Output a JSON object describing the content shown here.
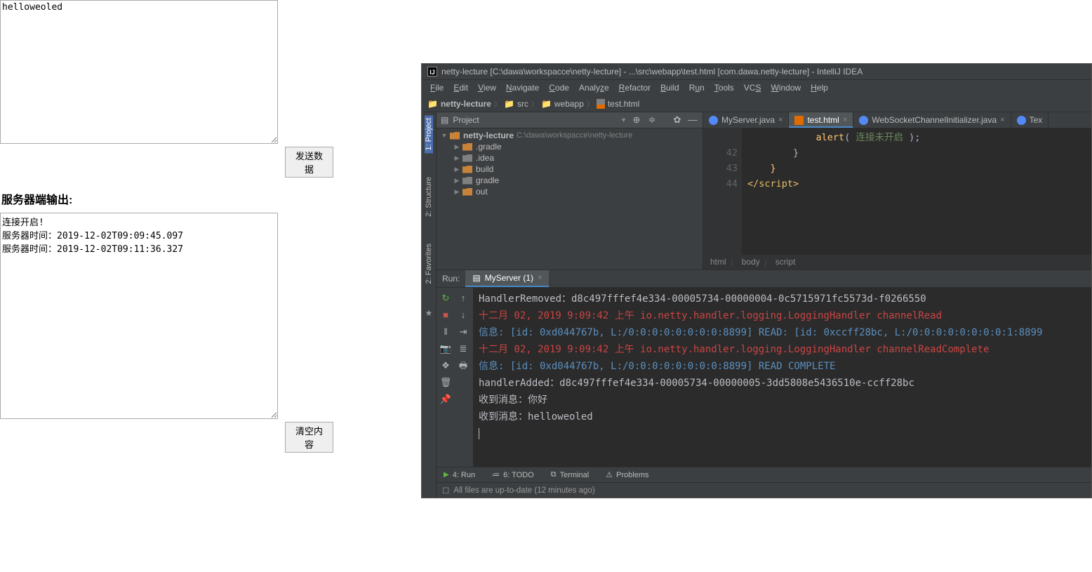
{
  "browser": {
    "input_value": "helloweoled",
    "send_button": "发送数据",
    "output_title": "服务器端输出:",
    "output_value": "连接开启!\n服务器时间：2019-12-02T09:09:45.097\n服务器时间：2019-12-02T09:11:36.327",
    "clear_button": "清空内容"
  },
  "ide": {
    "title": "netty-lecture [C:\\dawa\\workspacce\\netty-lecture] - ...\\src\\webapp\\test.html [com.dawa.netty-lecture] - IntelliJ IDEA",
    "menu": [
      "File",
      "Edit",
      "View",
      "Navigate",
      "Code",
      "Analyze",
      "Refactor",
      "Build",
      "Run",
      "Tools",
      "VCS",
      "Window",
      "Help"
    ],
    "path": {
      "root": "netty-lecture",
      "src": "src",
      "webapp": "webapp",
      "file": "test.html"
    },
    "project": {
      "header": "Project",
      "root_name": "netty-lecture",
      "root_path": "C:\\dawa\\workspacce\\netty-lecture",
      "folders": [
        ".gradle",
        ".idea",
        "build",
        "gradle",
        "out"
      ]
    },
    "editor_tabs": [
      {
        "label": "MyServer.java",
        "type": "java"
      },
      {
        "label": "test.html",
        "type": "html",
        "active": true
      },
      {
        "label": "WebSocketChannelInitializer.java",
        "type": "java"
      },
      {
        "label": "Tex",
        "type": "java"
      }
    ],
    "code_lines": {
      "l42": "42",
      "l43": "43",
      "l44": "44"
    },
    "breadcrumbs": [
      "html",
      "body",
      "script"
    ],
    "run": {
      "label": "Run:",
      "tab": "MyServer (1)"
    },
    "console_lines": [
      {
        "cls": "",
        "text": "HandlerRemoved：d8c497fffef4e334-00005734-00000004-0c5715971fc5573d-f0266550"
      },
      {
        "cls": "red",
        "text": "十二月 02, 2019 9:09:42 上午 io.netty.handler.logging.LoggingHandler channelRead"
      },
      {
        "cls": "blue",
        "text": "信息: [id: 0xd044767b, L:/0:0:0:0:0:0:0:0:8899] READ: [id: 0xccff28bc, L:/0:0:0:0:0:0:0:0:1:8899"
      },
      {
        "cls": "red",
        "text": "十二月 02, 2019 9:09:42 上午 io.netty.handler.logging.LoggingHandler channelReadComplete"
      },
      {
        "cls": "blue",
        "text": "信息: [id: 0xd044767b, L:/0:0:0:0:0:0:0:0:8899] READ COMPLETE"
      },
      {
        "cls": "",
        "text": "handlerAdded：d8c497fffef4e334-00005734-00000005-3dd5808e5436510e-ccff28bc"
      },
      {
        "cls": "",
        "text": "收到消息：你好"
      },
      {
        "cls": "",
        "text": "收到消息：helloweoled"
      }
    ],
    "bottom": {
      "run": "4: Run",
      "todo": "6: TODO",
      "terminal": "Terminal",
      "problems": "Problems"
    },
    "status": "All files are up-to-date (12 minutes ago)",
    "left_strip": {
      "project": "1: Project",
      "structure": "2: Structure",
      "favorites": "2: Favorites"
    }
  }
}
